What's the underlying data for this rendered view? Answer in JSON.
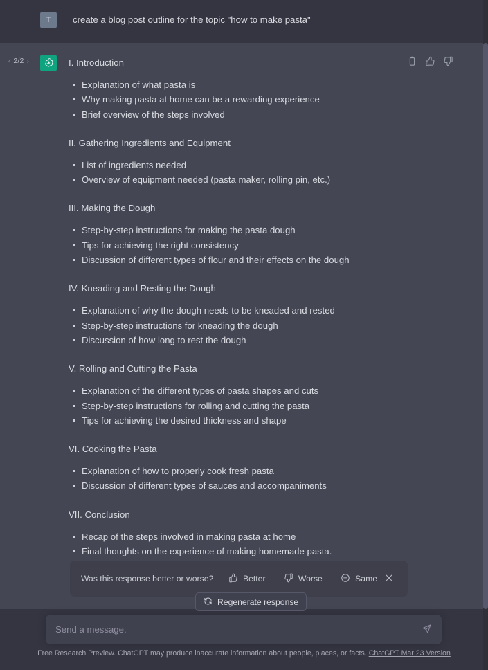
{
  "user_message": {
    "avatar_initial": "T",
    "text": "create a blog post outline for the topic \"how to make pasta\""
  },
  "assistant_message": {
    "pager": {
      "prev": "‹",
      "count": "2/2",
      "next": "›"
    },
    "actions": [
      {
        "name": "copy-icon",
        "label": "Copy"
      },
      {
        "name": "thumbs-up-icon",
        "label": "Good response"
      },
      {
        "name": "thumbs-down-icon",
        "label": "Bad response"
      }
    ],
    "sections": [
      {
        "heading": "I. Introduction",
        "bullets": [
          "Explanation of what pasta is",
          "Why making pasta at home can be a rewarding experience",
          "Brief overview of the steps involved"
        ]
      },
      {
        "heading": "II. Gathering Ingredients and Equipment",
        "bullets": [
          "List of ingredients needed",
          "Overview of equipment needed (pasta maker, rolling pin, etc.)"
        ]
      },
      {
        "heading": "III. Making the Dough",
        "bullets": [
          "Step-by-step instructions for making the pasta dough",
          "Tips for achieving the right consistency",
          "Discussion of different types of flour and their effects on the dough"
        ]
      },
      {
        "heading": "IV. Kneading and Resting the Dough",
        "bullets": [
          "Explanation of why the dough needs to be kneaded and rested",
          "Step-by-step instructions for kneading the dough",
          "Discussion of how long to rest the dough"
        ]
      },
      {
        "heading": "V. Rolling and Cutting the Pasta",
        "bullets": [
          "Explanation of the different types of pasta shapes and cuts",
          "Step-by-step instructions for rolling and cutting the pasta",
          "Tips for achieving the desired thickness and shape"
        ]
      },
      {
        "heading": "VI. Cooking the Pasta",
        "bullets": [
          "Explanation of how to properly cook fresh pasta",
          "Discussion of different types of sauces and accompaniments"
        ]
      },
      {
        "heading": "VII. Conclusion",
        "bullets": [
          "Recap of the steps involved in making pasta at home",
          "Final thoughts on the experience of making homemade pasta."
        ]
      }
    ]
  },
  "feedback": {
    "question": "Was this response better or worse?",
    "better_label": "Better",
    "worse_label": "Worse",
    "same_label": "Same"
  },
  "regenerate": {
    "label": "Regenerate response"
  },
  "composer": {
    "placeholder": "Send a message.",
    "value": ""
  },
  "footer": {
    "text": "Free Research Preview. ChatGPT may produce inaccurate information about people, places, or facts.",
    "link_text": "ChatGPT Mar 23 Version"
  },
  "colors": {
    "user_row_bg": "#343541",
    "assistant_row_bg": "#444654",
    "accent_green": "#10a37f",
    "user_avatar": "#6d7a8c",
    "text": "#d8dadf"
  }
}
